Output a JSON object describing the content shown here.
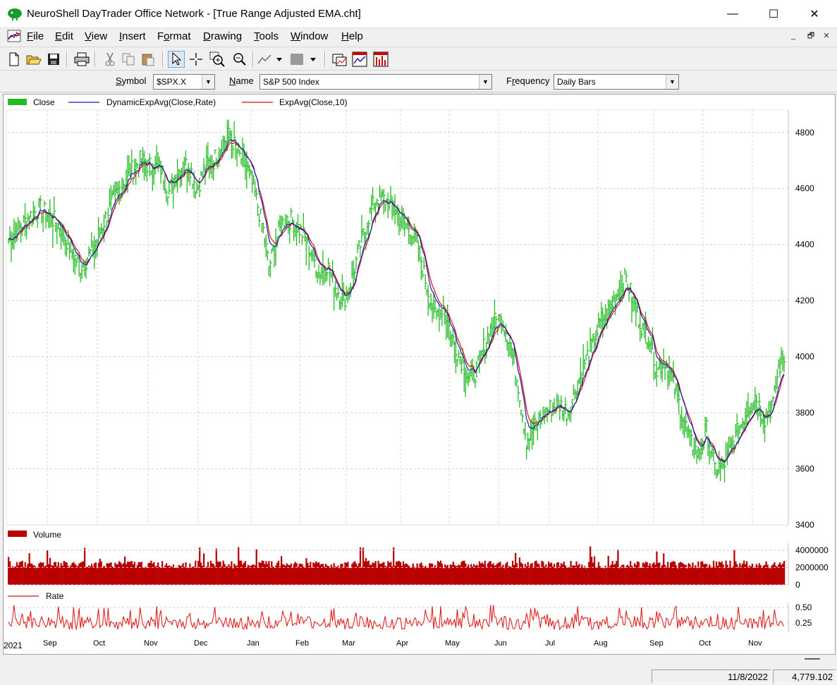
{
  "window": {
    "title": "NeuroShell DayTrader Office Network - [True Range Adjusted EMA.cht]",
    "minimize_glyph": "—",
    "maximize_glyph": "☐",
    "close_glyph": "✕"
  },
  "menu": {
    "items": [
      {
        "label": "File",
        "underline": "F",
        "rest": "ile"
      },
      {
        "label": "Edit",
        "underline": "E",
        "rest": "dit"
      },
      {
        "label": "View",
        "underline": "V",
        "rest": "iew"
      },
      {
        "label": "Insert",
        "underline": "I",
        "rest": "nsert"
      },
      {
        "label": "Format",
        "underline": "F",
        "rest": "ormat",
        "prefix": ""
      },
      {
        "label": "Drawing",
        "underline": "D",
        "rest": "rawing"
      },
      {
        "label": "Tools",
        "underline": "T",
        "rest": "ools"
      },
      {
        "label": "Window",
        "underline": "W",
        "rest": "indow"
      },
      {
        "label": "Help",
        "underline": "H",
        "rest": "elp"
      }
    ],
    "mdi_minimize": "_",
    "mdi_restore": "🗗",
    "mdi_close": "✕"
  },
  "toolbar": {
    "icons": [
      "new-icon",
      "open-icon",
      "save-icon",
      "print-icon",
      "cut-icon",
      "copy-icon",
      "paste-icon",
      "pointer-icon",
      "crosshair-icon",
      "zoom-in-icon",
      "zoom-out-icon",
      "line-tool-icon",
      "fill-tool-icon",
      "chart-window-icon",
      "indicator-icon",
      "grid-icon"
    ]
  },
  "symbol_bar": {
    "symbol_label": "Symbol",
    "symbol_value": "$SPX.X",
    "name_label": "Name",
    "name_value": "S&P 500 Index",
    "frequency_label": "Frequency",
    "frequency_value": "Daily Bars"
  },
  "chart_data": [
    {
      "type": "line",
      "pane": "price",
      "legend": [
        {
          "name": "Close",
          "color": "#22bb22",
          "style": "bar"
        },
        {
          "name": "DynamicExpAvg(Close,Rate)",
          "color": "#1020b0",
          "style": "line"
        },
        {
          "name": "ExpAvg(Close,10)",
          "color": "#e01010",
          "style": "line"
        }
      ],
      "ylim": [
        3400,
        4880
      ],
      "y_ticks": [
        3400,
        3600,
        3800,
        4000,
        4200,
        4400,
        4600,
        4800
      ],
      "x_start_label": "2021",
      "x_month_labels": [
        "Sep",
        "Oct",
        "Nov",
        "Dec",
        "Jan",
        "Feb",
        "Mar",
        "Apr",
        "May",
        "Jun",
        "Jul",
        "Aug",
        "Sep",
        "Oct",
        "Nov"
      ],
      "close_keypoints": [
        [
          0,
          4420
        ],
        [
          8,
          4460
        ],
        [
          15,
          4500
        ],
        [
          22,
          4530
        ],
        [
          30,
          4500
        ],
        [
          38,
          4460
        ],
        [
          45,
          4380
        ],
        [
          52,
          4320
        ],
        [
          58,
          4360
        ],
        [
          64,
          4420
        ],
        [
          72,
          4520
        ],
        [
          80,
          4600
        ],
        [
          88,
          4660
        ],
        [
          95,
          4700
        ],
        [
          102,
          4680
        ],
        [
          110,
          4670
        ],
        [
          116,
          4590
        ],
        [
          122,
          4660
        ],
        [
          130,
          4690
        ],
        [
          136,
          4600
        ],
        [
          142,
          4680
        ],
        [
          148,
          4700
        ],
        [
          154,
          4760
        ],
        [
          160,
          4790
        ],
        [
          166,
          4720
        ],
        [
          172,
          4680
        ],
        [
          178,
          4580
        ],
        [
          184,
          4450
        ],
        [
          188,
          4320
        ],
        [
          194,
          4430
        ],
        [
          200,
          4500
        ],
        [
          206,
          4480
        ],
        [
          212,
          4440
        ],
        [
          218,
          4380
        ],
        [
          224,
          4300
        ],
        [
          230,
          4330
        ],
        [
          236,
          4250
        ],
        [
          242,
          4200
        ],
        [
          248,
          4280
        ],
        [
          254,
          4400
        ],
        [
          260,
          4500
        ],
        [
          266,
          4570
        ],
        [
          272,
          4560
        ],
        [
          278,
          4530
        ],
        [
          284,
          4480
        ],
        [
          290,
          4460
        ],
        [
          296,
          4390
        ],
        [
          302,
          4250
        ],
        [
          308,
          4150
        ],
        [
          314,
          4180
        ],
        [
          320,
          4070
        ],
        [
          326,
          4000
        ],
        [
          332,
          3930
        ],
        [
          338,
          3950
        ],
        [
          344,
          4050
        ],
        [
          350,
          4120
        ],
        [
          356,
          4140
        ],
        [
          362,
          4050
        ],
        [
          368,
          3900
        ],
        [
          374,
          3700
        ],
        [
          380,
          3750
        ],
        [
          386,
          3800
        ],
        [
          392,
          3820
        ],
        [
          398,
          3830
        ],
        [
          404,
          3800
        ],
        [
          410,
          3900
        ],
        [
          416,
          3980
        ],
        [
          422,
          4050
        ],
        [
          428,
          4130
        ],
        [
          434,
          4170
        ],
        [
          440,
          4230
        ],
        [
          446,
          4280
        ],
        [
          452,
          4180
        ],
        [
          458,
          4100
        ],
        [
          464,
          4060
        ],
        [
          468,
          3950
        ],
        [
          474,
          3990
        ],
        [
          480,
          3900
        ],
        [
          486,
          3800
        ],
        [
          492,
          3700
        ],
        [
          498,
          3650
        ],
        [
          504,
          3740
        ],
        [
          510,
          3600
        ],
        [
          516,
          3610
        ],
        [
          522,
          3680
        ],
        [
          528,
          3750
        ],
        [
          534,
          3820
        ],
        [
          540,
          3850
        ],
        [
          546,
          3780
        ],
        [
          552,
          3830
        ],
        [
          556,
          3960
        ],
        [
          560,
          4000
        ]
      ],
      "volume": {
        "name": "Volume",
        "color": "#bb0000",
        "y_ticks": [
          0,
          2000000,
          4000000
        ]
      },
      "rate": {
        "name": "Rate",
        "color": "#e01010",
        "y_ticks": [
          0.25,
          0.5
        ]
      }
    }
  ],
  "status": {
    "date": "11/8/2022",
    "value": "4,779.102"
  }
}
